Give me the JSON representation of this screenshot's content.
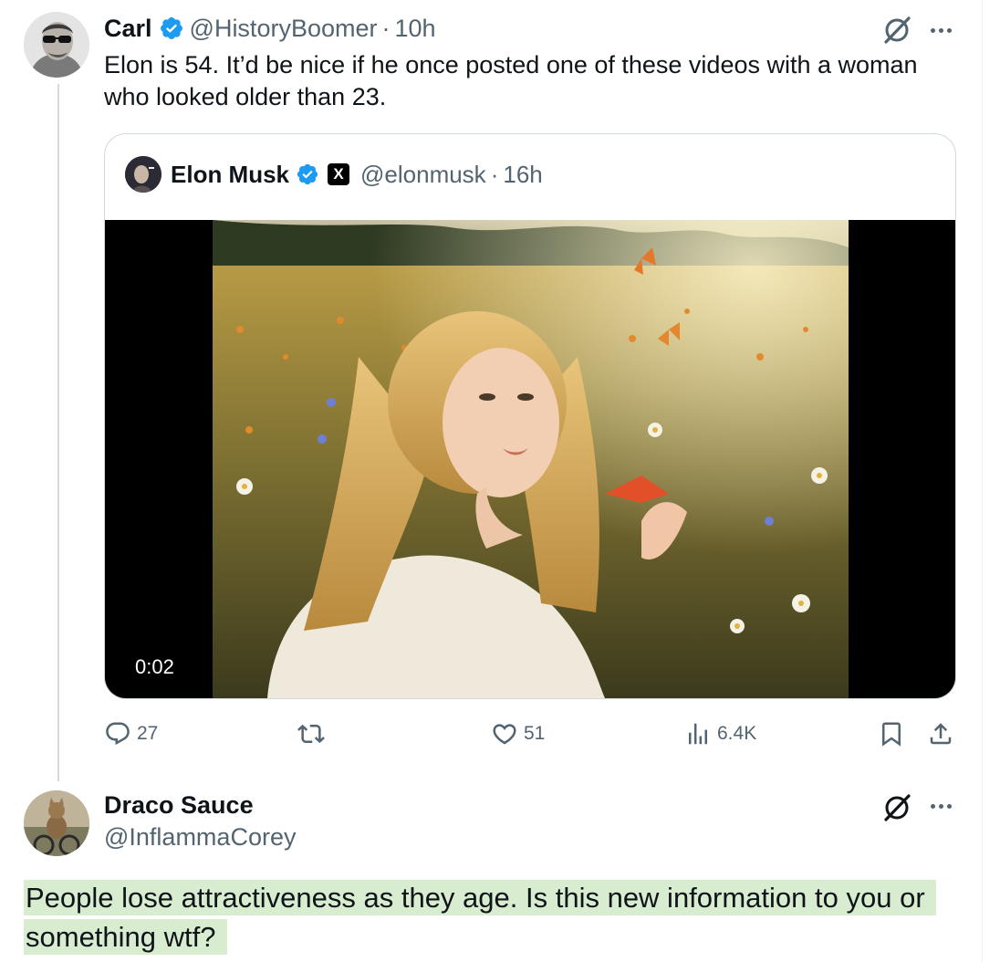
{
  "tweet": {
    "author_name": "Carl",
    "author_handle": "@HistoryBoomer",
    "time": "10h",
    "separator": "·",
    "text": "Elon is 54. It’d be nice if he once posted one of these videos with a woman who looked older than 23."
  },
  "quoted_tweet": {
    "author_name": "Elon Musk",
    "author_handle": "@elonmusk",
    "time": "16h",
    "separator": "·",
    "affiliate_badge": "X",
    "video_timestamp": "0:02"
  },
  "actions": {
    "replies": "27",
    "reposts": "",
    "likes": "51",
    "views": "6.4K"
  },
  "reply": {
    "author_name": "Draco Sauce",
    "author_handle": "@InflammaCorey",
    "text": "People lose attractiveness as they age. Is this new information to you or something wtf?"
  },
  "icons": [
    "verified-badge-icon",
    "grok-icon",
    "more-icon",
    "reply-icon",
    "repost-icon",
    "like-icon",
    "views-icon",
    "bookmark-icon",
    "share-icon"
  ],
  "colors": {
    "verified": "#1d9bf0",
    "muted_text": "#536471",
    "text": "#0f1419",
    "border": "#cfd9de",
    "highlight": "#d8ecd0"
  }
}
